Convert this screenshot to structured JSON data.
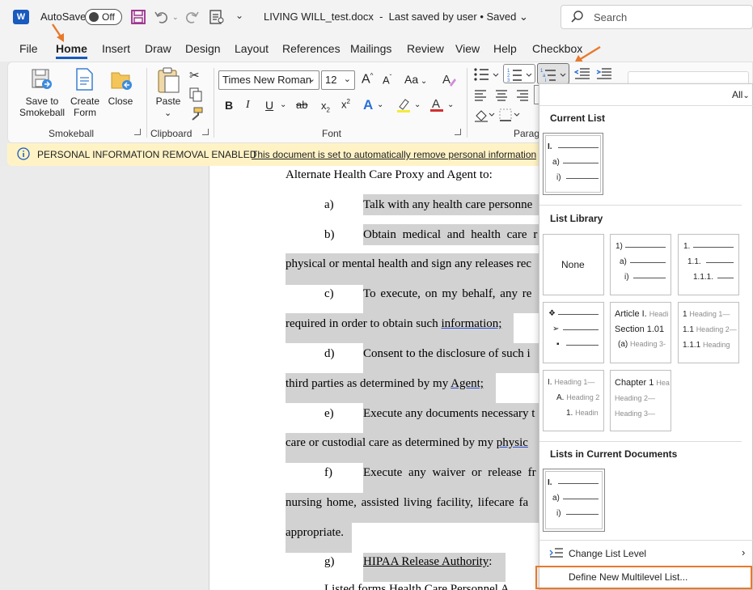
{
  "titlebar": {
    "app_icon": "W",
    "autosave_label": "AutoSave",
    "autosave_state": "Off",
    "doc_title": "LIVING WILL_test.docx",
    "save_status": "Last saved by user • Saved",
    "search_placeholder": "Search"
  },
  "menu": {
    "tabs": [
      "File",
      "Home",
      "Insert",
      "Draw",
      "Design",
      "Layout",
      "References",
      "Mailings",
      "Review",
      "View",
      "Help",
      "Checkbox"
    ],
    "active_tab": "Home"
  },
  "ribbon": {
    "smokeball": {
      "save_label_1": "Save to",
      "save_label_2": "Smokeball",
      "create_label_1": "Create",
      "create_label_2": "Form",
      "close_label": "Close",
      "group_label": "Smokeball"
    },
    "clipboard": {
      "paste_label": "Paste",
      "group_label": "Clipboard"
    },
    "font": {
      "font_name": "Times New Roman",
      "font_size": "12",
      "group_label": "Font"
    },
    "paragraph": {
      "group_label": "Parag"
    }
  },
  "infobar": {
    "title": "PERSONAL INFORMATION REMOVAL ENABLED",
    "message": "This document is set to automatically remove personal information"
  },
  "document": {
    "lines": [
      {
        "text": "Alternate Health Care Proxy and Agent to:"
      },
      {
        "label": "a)",
        "text": "Talk with any health care personne"
      },
      {
        "label": "b)",
        "text": "Obtain medical and health care r"
      },
      {
        "text": "physical or mental health and sign any releases rec"
      },
      {
        "label": "c)",
        "text": "To execute, on my behalf, any re"
      },
      {
        "text": "required in order to obtain such",
        "link": "information;"
      },
      {
        "label": "d)",
        "text": "Consent to the disclosure of such i"
      },
      {
        "text": "third parties as determined by my",
        "link": "Agent;"
      },
      {
        "label": "e)",
        "text": "Execute any documents necessary t"
      },
      {
        "text": "care or custodial care as determined by my",
        "link": "physic"
      },
      {
        "label": "f)",
        "text": "Execute any waiver or release fr"
      },
      {
        "text": "nursing home, assisted living facility, lifecare fa"
      },
      {
        "text": "appropriate."
      },
      {
        "label": "g)",
        "link": "HIPAA Release Authority",
        "suffix": ":"
      },
      {
        "text": "Listed forms Health Care Personnel A"
      }
    ]
  },
  "panel": {
    "filter": "All",
    "current_list_title": "Current List",
    "list_library_title": "List Library",
    "lists_in_docs_title": "Lists in Current Documents",
    "none_label": "None",
    "current_tile": [
      "I.",
      "a)",
      "i)"
    ],
    "lib_tile_1": [
      "1)",
      "a)",
      "i)"
    ],
    "lib_tile_2": [
      "1.",
      "1.1.",
      "1.1.1."
    ],
    "lib_tile_3": [
      "❖",
      "➢",
      "▪"
    ],
    "lib_tile_4": [
      "Article I.",
      "Headi",
      "Section 1.01",
      "(a)",
      "Heading 3-"
    ],
    "lib_tile_5": [
      "1",
      "Heading 1—",
      "1.1",
      "Heading 2—",
      "1.1.1",
      "Heading"
    ],
    "lib_tile_6": [
      "I.",
      "Heading 1—",
      "A.",
      "Heading 2",
      "1.",
      "Headin"
    ],
    "lib_tile_7": [
      "Chapter 1",
      "Hea",
      "Heading 2—",
      "Heading 3—"
    ],
    "doc_tile": [
      "I.",
      "a)",
      "i)"
    ],
    "change_level": "Change List Level",
    "define_new": "Define New Multilevel List..."
  },
  "colors": {
    "accent": "#185abd",
    "annotation": "#e8792b",
    "highlight": "#d2d2d2",
    "infobar": "#fff3c6"
  }
}
